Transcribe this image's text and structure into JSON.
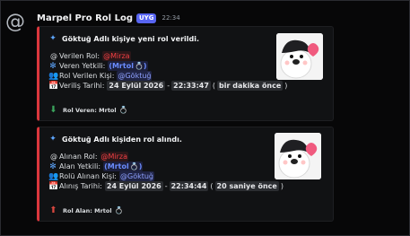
{
  "message": {
    "bot_name": "Marpel Pro Rol Log",
    "app_tag": "UYG",
    "timestamp": "22:34"
  },
  "embeds": [
    {
      "accent_color": "#da373c",
      "title": "Göktuğ Adlı kişiye yeni rol verildi.",
      "fields": {
        "role_label": "Verilen Rol:",
        "role_value": "@Mirza",
        "by_label": "Veren Yetkili:",
        "by_value": "(Mrtol",
        "by_close": ")",
        "target_label": "Rol Verilen Kişi:",
        "target_value": "@Göktuğ",
        "date_label": "Veriliş Tarihi:",
        "date_value": "24 Eylül 2026",
        "time_value": "22:33:47",
        "relative_value": "bir dakika önce"
      },
      "footer": "Rol Veren: Mrtol"
    },
    {
      "accent_color": "#da373c",
      "title": "Göktuğ Adlı kişiden rol alındı.",
      "fields": {
        "role_label": "Alınan Rol:",
        "role_value": "@Mirza",
        "by_label": "Alan Yetkili:",
        "by_value": "(Mrtol",
        "by_close": ")",
        "target_label": "Rolü Alınan Kişi:",
        "target_value": "@Göktuğ",
        "date_label": "Alınış Tarihi:",
        "date_value": "24 Eylül 2026",
        "time_value": "22:34:44",
        "relative_value": "20 saniye önce"
      },
      "footer": "Rol Alan: Mrtol"
    }
  ],
  "icons": {
    "avatar": "discord-avatar-icon",
    "title": "sparkle-icon",
    "role": "at-sign-icon",
    "by": "snowflake-icon",
    "target": "users-icon",
    "date": "calendar-icon",
    "footer": "download-arrow-icon",
    "ring": "ring-icon",
    "thumbnail": "cartoon-character-thumbnail"
  }
}
